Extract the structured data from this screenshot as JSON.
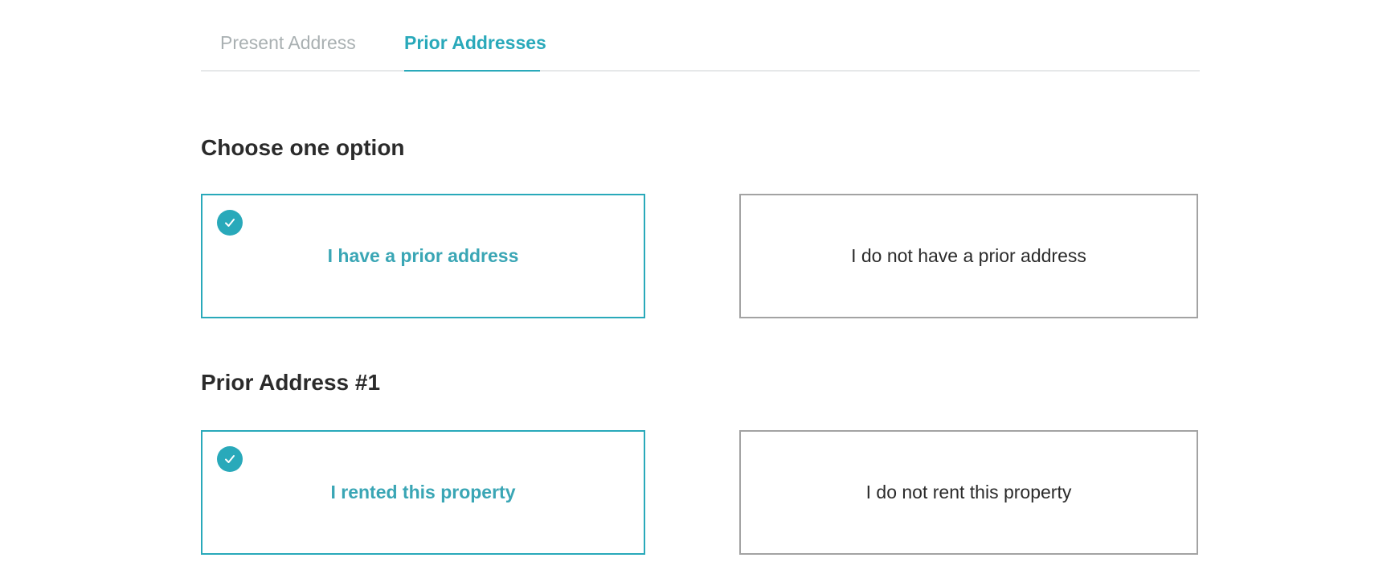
{
  "tabs": [
    {
      "label": "Present Address",
      "active": false
    },
    {
      "label": "Prior Addresses",
      "active": true
    }
  ],
  "sections": [
    {
      "heading": "Choose one option",
      "options": [
        {
          "label": "I have a prior address",
          "selected": true
        },
        {
          "label": "I do not have a prior address",
          "selected": false
        }
      ]
    },
    {
      "heading": "Prior Address #1",
      "options": [
        {
          "label": "I rented this property",
          "selected": true
        },
        {
          "label": "I do not rent this property",
          "selected": false
        }
      ]
    }
  ],
  "colors": {
    "accent": "#29a9ba",
    "text": "#2b2b2b",
    "muted": "#a9b0b2",
    "border": "#a3a3a3",
    "divider": "#e6e8e9"
  },
  "icons": {
    "selected_marker": "checkmark-circle-icon"
  }
}
